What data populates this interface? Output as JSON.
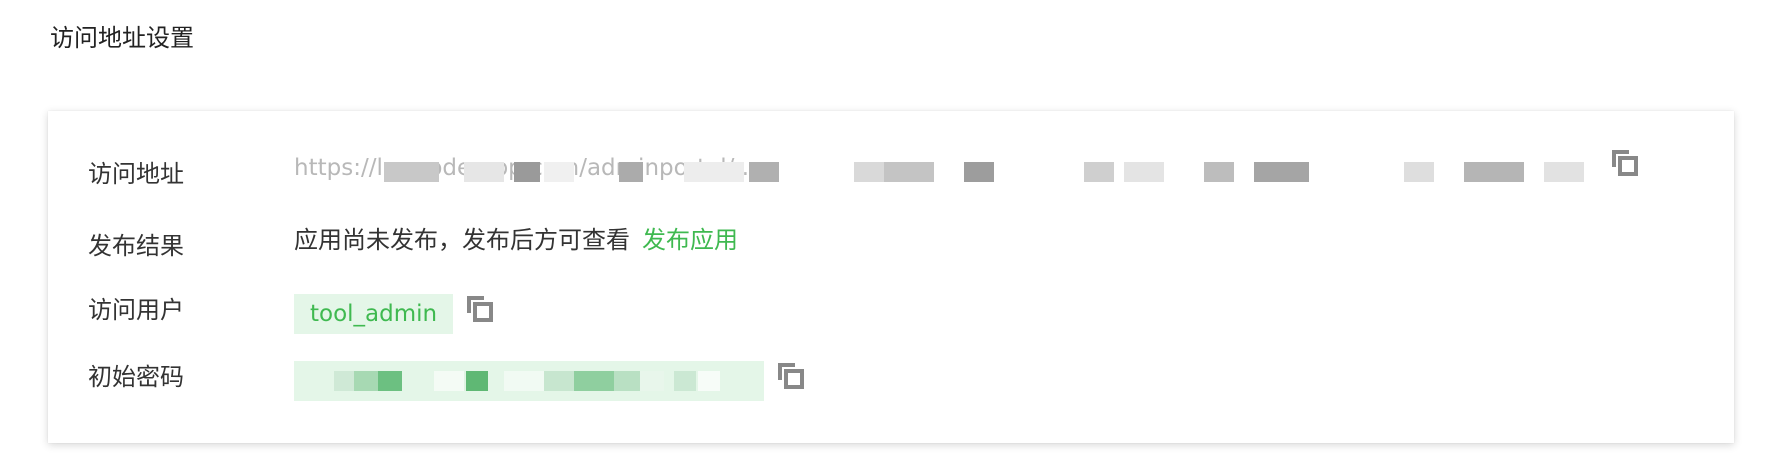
{
  "section": {
    "title": "访问地址设置"
  },
  "rows": {
    "address": {
      "label": "访问地址",
      "value": "https://lowcode-app.com/adminportal/...",
      "copy_icon": "copy-icon"
    },
    "publish": {
      "label": "发布结果",
      "text": "应用尚未发布，发布后方可查看",
      "link": "发布应用"
    },
    "user": {
      "label": "访问用户",
      "value": "tool_admin",
      "copy_icon": "copy-icon"
    },
    "password": {
      "label": "初始密码",
      "copy_icon": "copy-icon"
    }
  },
  "colors": {
    "accent": "#3fb950",
    "tag_bg": "#e4f6e8",
    "muted_text": "#b8b8b8",
    "icon": "#888888"
  }
}
